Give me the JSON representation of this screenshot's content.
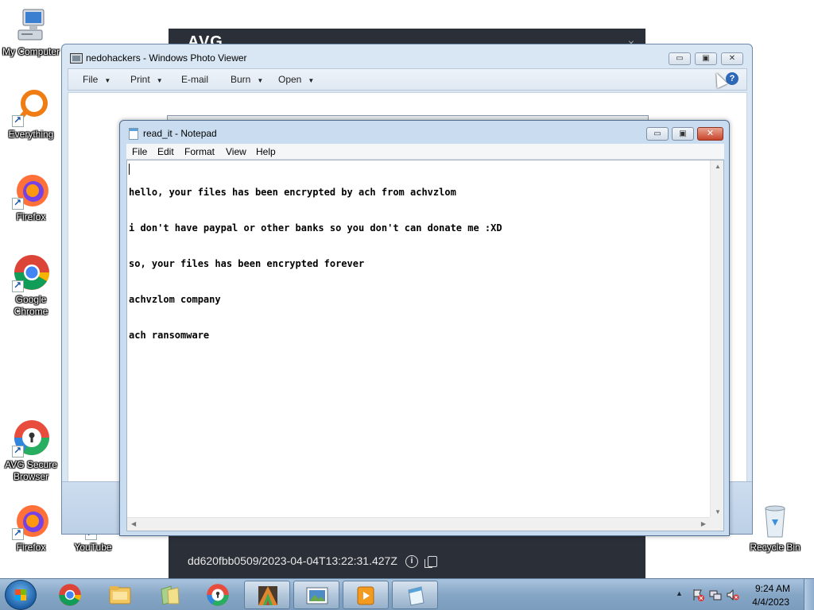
{
  "desktop": {
    "icons": [
      {
        "label": "My Computer",
        "icon": "computer-icon"
      },
      {
        "label": "Everything",
        "icon": "everything-search-icon"
      },
      {
        "label": "Firefox",
        "icon": "firefox-icon"
      },
      {
        "label": "Google Chrome",
        "icon": "chrome-icon"
      },
      {
        "label": "AVG Secure Browser",
        "icon": "avg-secure-browser-icon"
      },
      {
        "label": "Firefox",
        "icon": "firefox-icon"
      },
      {
        "label": "YouTube",
        "icon": "youtube-shortcut-icon"
      },
      {
        "label": "Recycle Bin",
        "icon": "recycle-bin-icon"
      }
    ]
  },
  "avg_window": {
    "logo": "AVG",
    "close_glyph": "×",
    "machine_id": "dd620fbb0509/2023-04-04T13:22:31.427Z",
    "info_glyph": "i"
  },
  "photo_viewer": {
    "title": "nedohackers - Windows Photo Viewer",
    "menu": {
      "file": "File",
      "print": "Print",
      "email": "E-mail",
      "burn": "Burn",
      "open": "Open"
    },
    "help_glyph": "?",
    "controls": {
      "minimize": "▭",
      "maximize": "▣",
      "close": "✕"
    }
  },
  "notepad": {
    "title": "read_it - Notepad",
    "menu": {
      "file": "File",
      "edit": "Edit",
      "format": "Format",
      "view": "View",
      "help": "Help"
    },
    "controls": {
      "minimize": "▭",
      "maximize": "▣",
      "close": "✕"
    },
    "content_lines": [
      "hello, your files has been encrypted by ach from achvzlom",
      "i don't have paypal or other banks so you don't can donate me :XD",
      "so, your files has been encrypted forever",
      "achvzlom company",
      "ach ransomware"
    ]
  },
  "taskbar": {
    "pinned": [
      {
        "name": "chrome",
        "icon": "chrome-icon"
      },
      {
        "name": "windows-explorer",
        "icon": "folder-icon"
      },
      {
        "name": "files",
        "icon": "files-icon"
      },
      {
        "name": "avg-browser",
        "icon": "avg-secure-browser-icon"
      },
      {
        "name": "avg-antivirus",
        "icon": "avg-icon"
      },
      {
        "name": "photo-viewer",
        "icon": "photo-viewer-icon"
      },
      {
        "name": "media-player",
        "icon": "media-player-icon"
      },
      {
        "name": "notepad",
        "icon": "notepad-icon"
      }
    ],
    "tray_arrow": "▲",
    "clock_time": "9:24 AM",
    "clock_date": "4/4/2023"
  },
  "colors": {
    "taskbar": "#8aa9c9",
    "avg_dark": "#2b2f38",
    "notepad_frame": "#c9dcf0",
    "close_red": "#c8442a"
  }
}
